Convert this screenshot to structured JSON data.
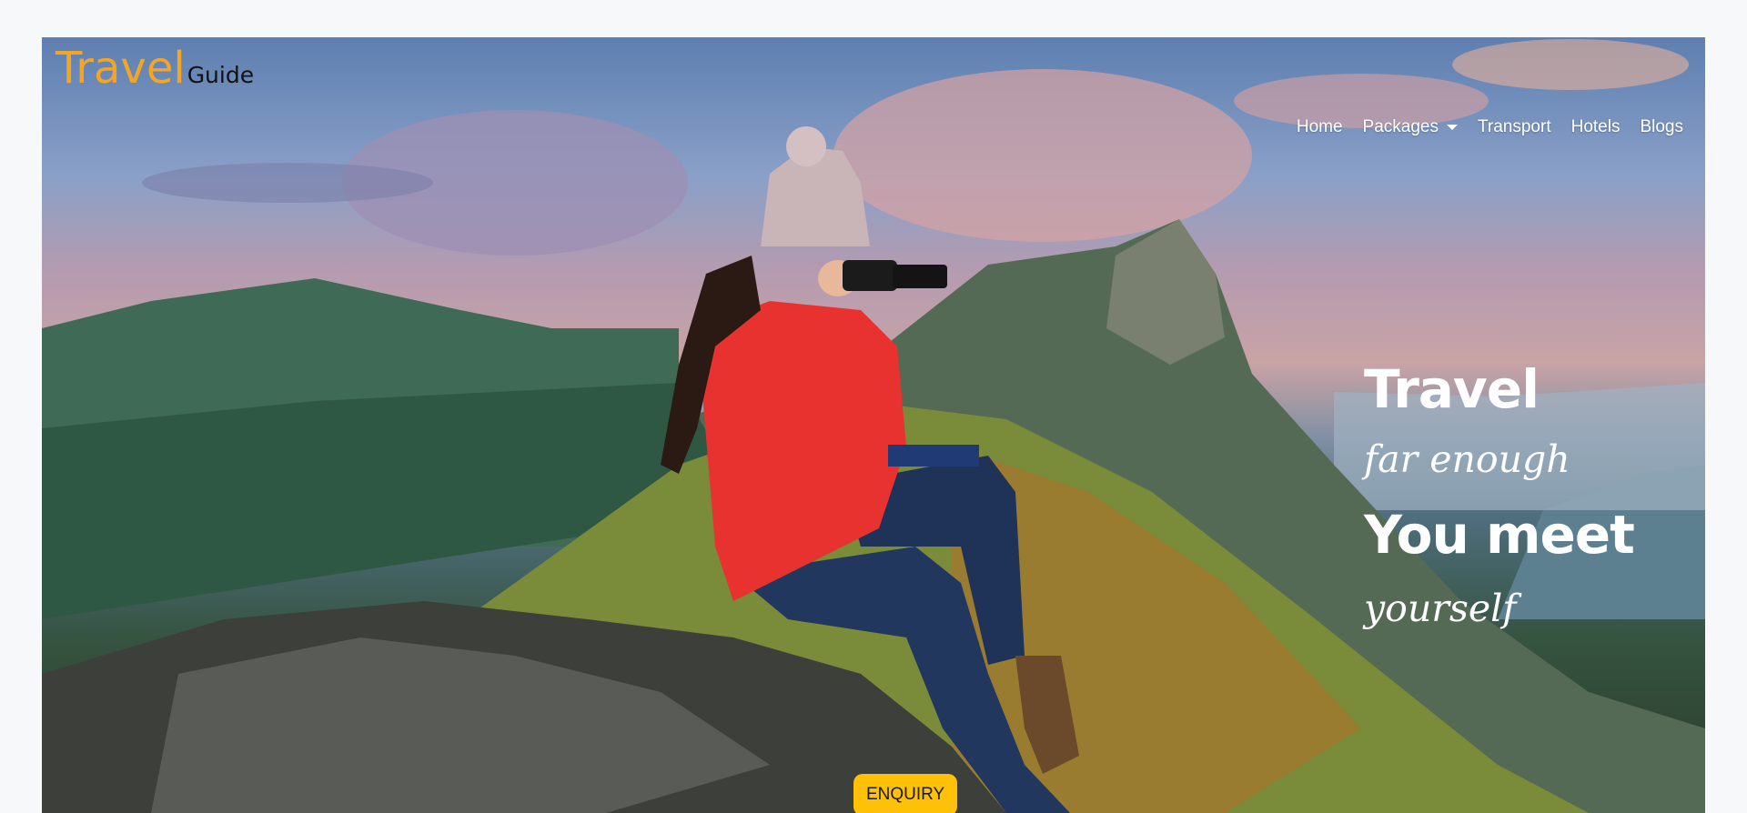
{
  "brand": {
    "travel": "Travel",
    "guide": "Guide"
  },
  "nav": {
    "home": "Home",
    "packages": "Packages",
    "transport": "Transport",
    "hotels": "Hotels",
    "blogs": "Blogs"
  },
  "hero": {
    "line1": "Travel",
    "line2": "far enough",
    "line3": "You meet",
    "line4": "yourself",
    "enquiry_label": "ENQUIRY"
  },
  "colors": {
    "brand_accent": "#f5a524",
    "button": "#ffc107",
    "jacket": "#e8322f"
  },
  "icons": {
    "dropdown": "caret-down-icon"
  }
}
